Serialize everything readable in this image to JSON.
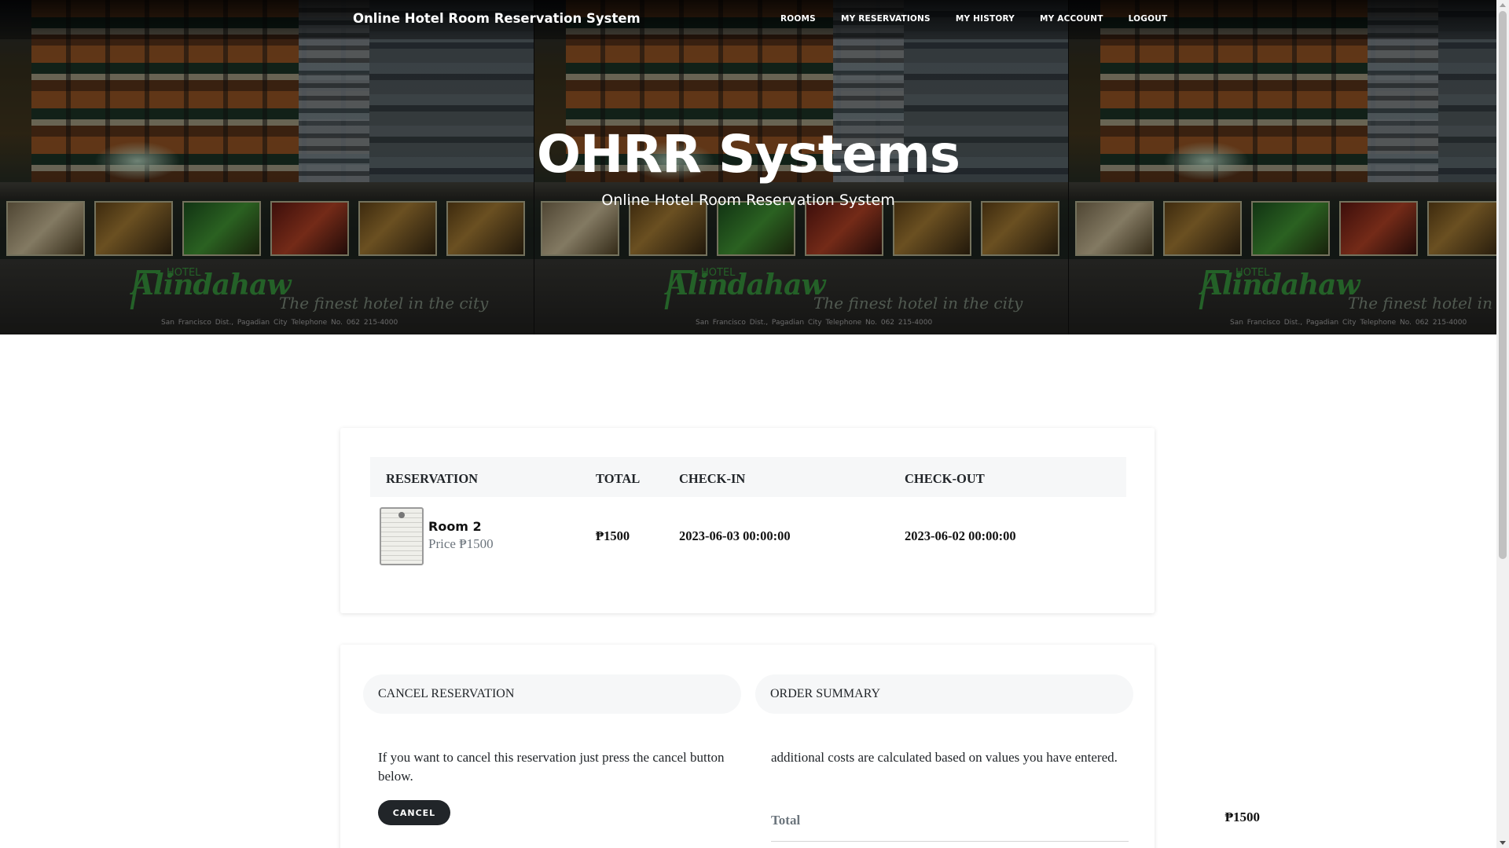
{
  "nav": {
    "brand": "Online Hotel Room Reservation System",
    "links": [
      "ROOMS",
      "MY RESERVATIONS",
      "MY HISTORY",
      "MY ACCOUNT",
      "LOGOUT"
    ]
  },
  "hero": {
    "title": "OHRR Systems",
    "subtitle": "Online Hotel Room Reservation System",
    "banner": {
      "hotel_word": "HOTEL",
      "hotel_name": "Alindahaw",
      "tagline": "The finest hotel in the city",
      "address": "San Francisco Dist., Pagadian City     Telephone No. 062 215-4000"
    }
  },
  "reservation_table": {
    "headers": [
      "RESERVATION",
      "TOTAL",
      "CHECK-IN",
      "CHECK-OUT"
    ],
    "rows": [
      {
        "room": "Room 2",
        "price": "Price ₱1500",
        "total": "₱1500",
        "check_in": "2023-06-03 00:00:00",
        "check_out": "2023-06-02 00:00:00"
      }
    ]
  },
  "cancel_panel": {
    "title": "CANCEL RESERVATION",
    "text": "If you want to cancel this reservation just press the cancel button below.",
    "button": "CANCEL"
  },
  "summary_panel": {
    "title": "ORDER SUMMARY",
    "text": "additional costs are calculated based on values you have entered.",
    "total_label": "Total",
    "total_value": "₱1500"
  },
  "colors": {
    "dark_button": "#212529",
    "header_bg": "#f6f7f8",
    "muted_text": "#6c757d",
    "brand_green": "#3fa845"
  }
}
